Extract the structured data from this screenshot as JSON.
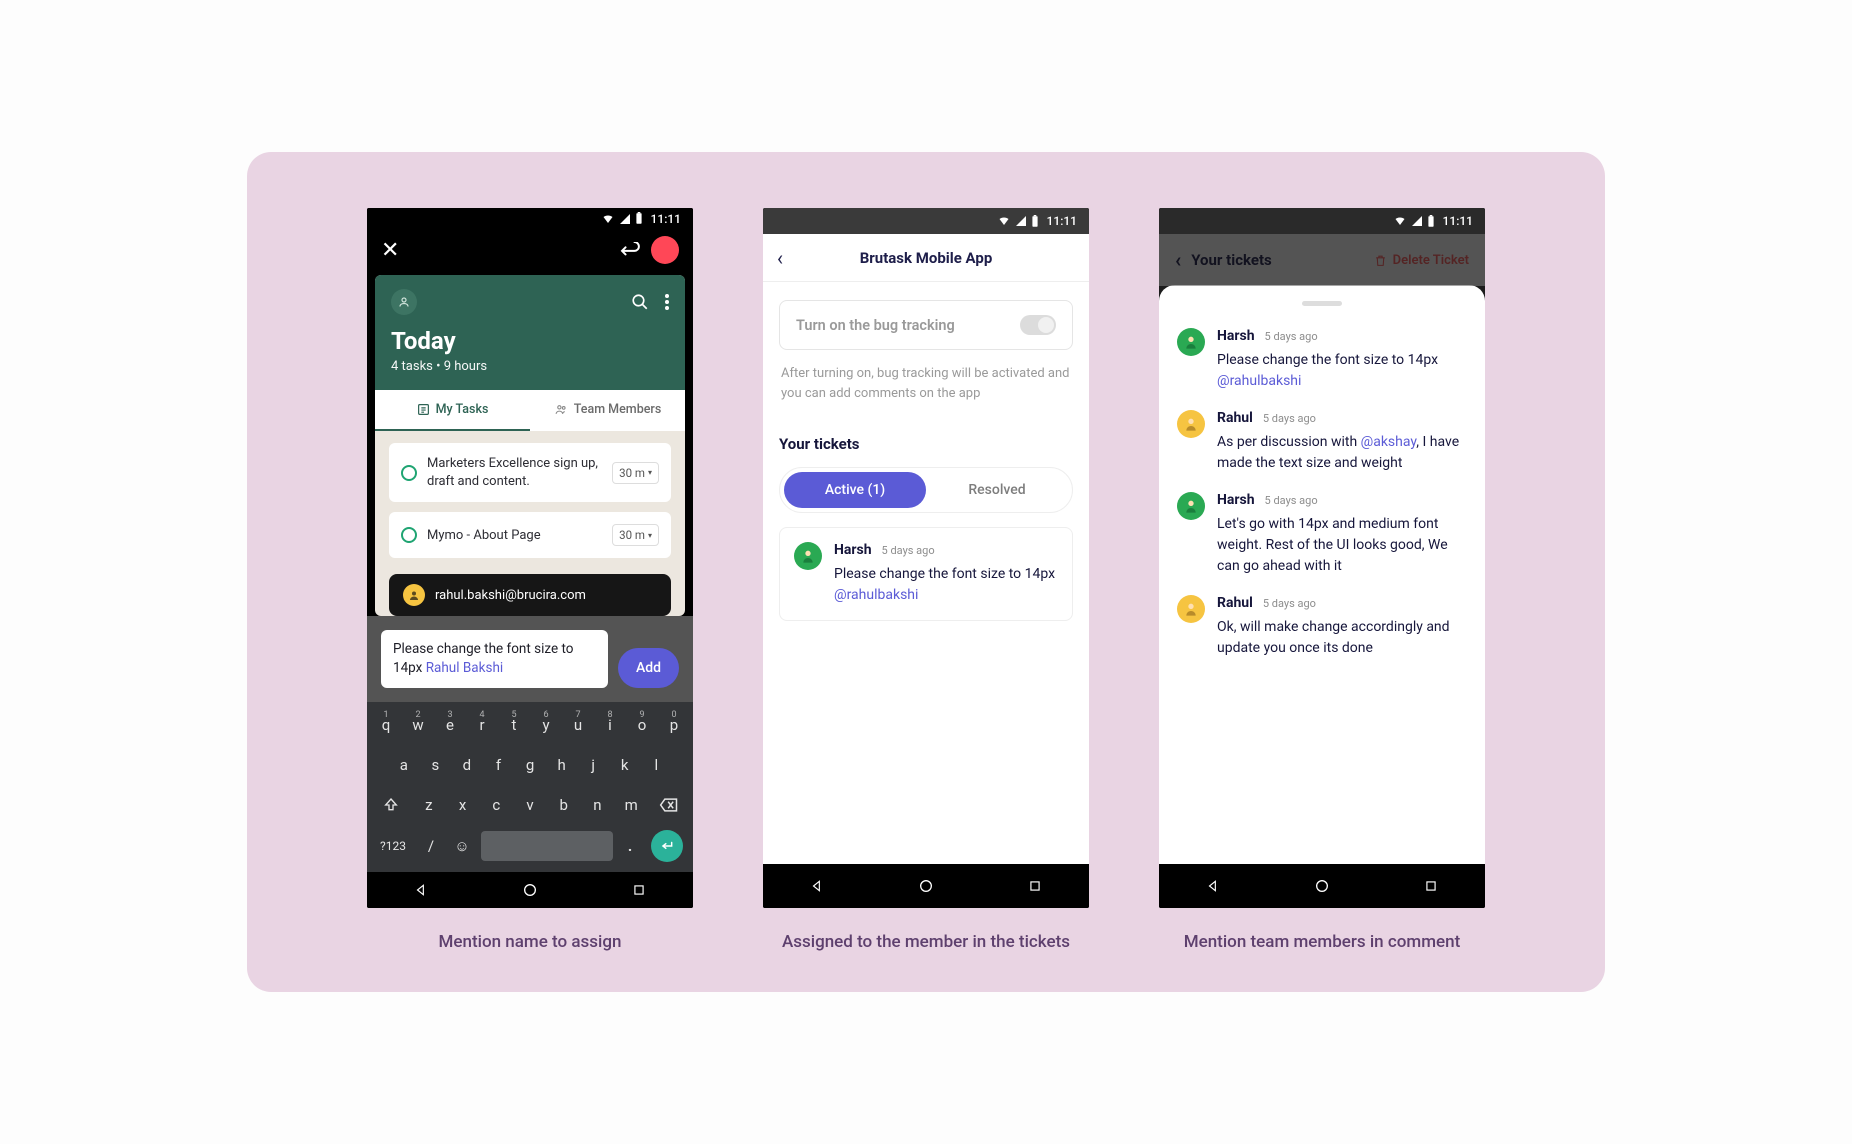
{
  "status_time": "11:11",
  "captions": {
    "p1": "Mention name to assign",
    "p2": "Assigned to the member in the tickets",
    "p3": "Mention team members in comment"
  },
  "phone1": {
    "header_title": "Today",
    "header_sub": "4 tasks  •  9 hours",
    "tab_my_tasks": "My Tasks",
    "tab_team": "Team Members",
    "tasks": [
      {
        "text": "Marketers Excellence sign up, draft and content.",
        "duration": "30 m"
      },
      {
        "text": "Mymo - About Page",
        "duration": "30 m"
      }
    ],
    "mention_email": "rahul.bakshi@brucira.com",
    "input_prefix": "Please change the font size to 14px ",
    "input_mention": "Rahul Bakshi",
    "add_btn": "Add",
    "sym_label": "?123"
  },
  "phone2": {
    "title": "Brutask Mobile App",
    "toggle_label": "Turn on the bug tracking",
    "help": "After turning on, bug tracking will be activated and you can add comments on the app",
    "section_title": "Your tickets",
    "seg_active": "Active (1)",
    "seg_resolved": "Resolved",
    "ticket": {
      "name": "Harsh",
      "time": "5 days ago",
      "text_pre": "Please change the font size to 14px ",
      "mention": "@rahulbakshi"
    }
  },
  "phone3": {
    "dim_title": "Your tickets",
    "delete": "Delete Ticket",
    "comments": [
      {
        "avatar": "g",
        "name": "Harsh",
        "time": "5 days ago",
        "pre": "Please change the font size to 14px ",
        "mention": "@rahulbakshi",
        "post": ""
      },
      {
        "avatar": "y",
        "name": "Rahul",
        "time": "5 days ago",
        "pre": "As per discussion with ",
        "mention": "@akshay",
        "post": ", I have made the text size and weight"
      },
      {
        "avatar": "g",
        "name": "Harsh",
        "time": "5 days ago",
        "pre": "Let's go with 14px and medium font weight. Rest of the UI looks good, We can go ahead with it",
        "mention": "",
        "post": ""
      },
      {
        "avatar": "y",
        "name": "Rahul",
        "time": "5 days ago",
        "pre": "Ok, will make change accordingly and update you once its done",
        "mention": "",
        "post": ""
      }
    ]
  }
}
